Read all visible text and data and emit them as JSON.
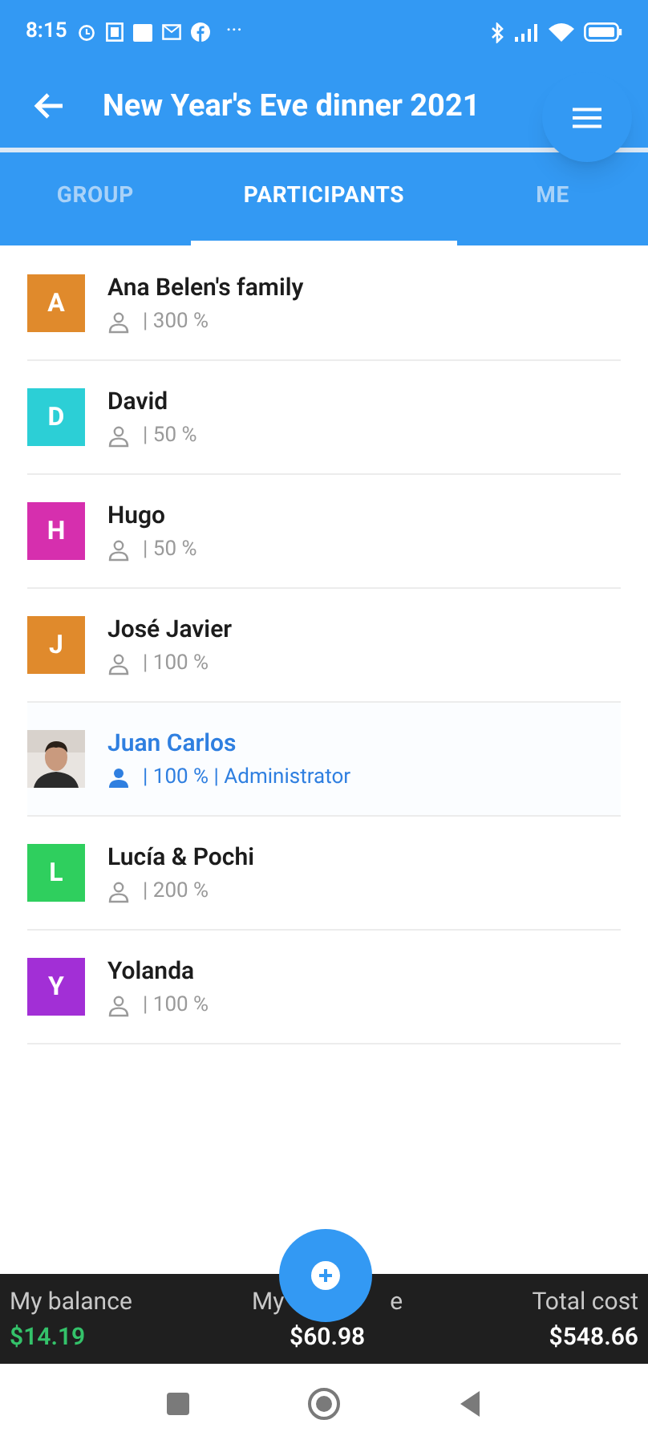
{
  "status_bar": {
    "time": "8:15",
    "more": "···"
  },
  "app_bar": {
    "title": "New Year's Eve dinner 2021"
  },
  "tabs": [
    {
      "label": "GROUP",
      "selected": false
    },
    {
      "label": "PARTICIPANTS",
      "selected": true
    },
    {
      "label": "ME",
      "selected": false
    }
  ],
  "participants": [
    {
      "kind": "letter",
      "initial": "A",
      "color": "#e08a2c",
      "name": "Ana Belen's family",
      "details": "| 300 %",
      "highlighted": false
    },
    {
      "kind": "letter",
      "initial": "D",
      "color": "#2ccfd6",
      "name": "David",
      "details": "| 50 %",
      "highlighted": false
    },
    {
      "kind": "letter",
      "initial": "H",
      "color": "#d62fae",
      "name": "Hugo",
      "details": "| 50 %",
      "highlighted": false
    },
    {
      "kind": "letter",
      "initial": "J",
      "color": "#e08a2c",
      "name": "José Javier",
      "details": "| 100 %",
      "highlighted": false
    },
    {
      "name": "Juan Carlos",
      "details": "| 100 % | Administrator",
      "highlighted": true
    },
    {
      "kind": "letter",
      "initial": "L",
      "color": "#2fcf5e",
      "name": "Lucía & Pochi",
      "details": "| 200 %",
      "highlighted": false
    },
    {
      "kind": "letter",
      "initial": "Y",
      "color": "#a22fd6",
      "name": "Yolanda",
      "details": "| 100 %",
      "highlighted": false
    }
  ],
  "summary": {
    "balance": {
      "label": "My balance",
      "value": "$14.19"
    },
    "share": {
      "label_start": "My",
      "label_end": "e",
      "value": "$60.98"
    },
    "total": {
      "label": "Total cost",
      "value": "$548.66"
    }
  }
}
